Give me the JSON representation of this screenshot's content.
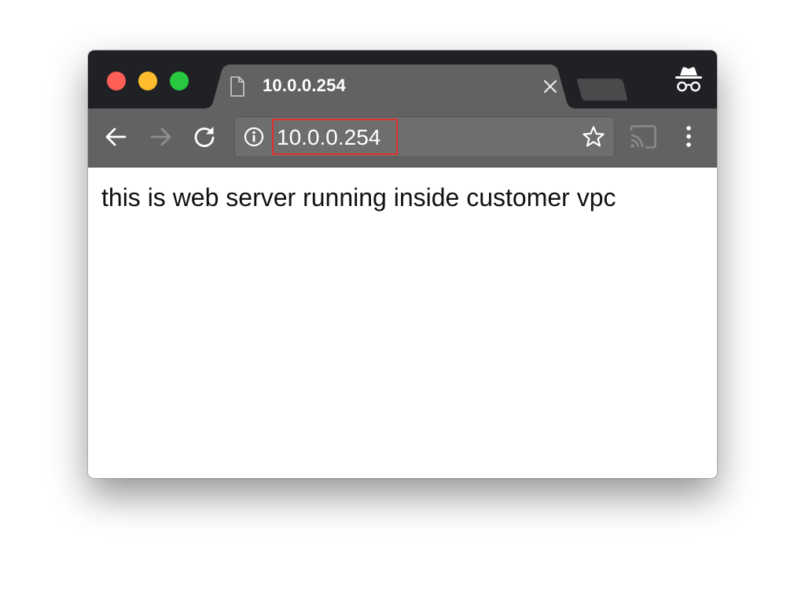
{
  "tab": {
    "title": "10.0.0.254",
    "icons": {
      "page": "document-icon",
      "close": "close-icon"
    }
  },
  "window_controls": {
    "close": "close-button",
    "minimize": "minimize-button",
    "maximize": "zoom-button"
  },
  "toolbar": {
    "back_icon": "arrow-left-icon",
    "forward_icon": "arrow-right-icon",
    "reload_icon": "reload-icon",
    "cast_icon": "cast-icon",
    "menu_icon": "three-dot-menu-icon"
  },
  "address_bar": {
    "url": "10.0.0.254",
    "site_info_icon": "info-icon",
    "bookmark_icon": "star-icon",
    "highlight_color": "#e0302a"
  },
  "profile": {
    "icon": "incognito-icon"
  },
  "page": {
    "body_text": "this is web server running inside customer vpc"
  },
  "colors": {
    "tabstrip": "#202124",
    "active_tab": "#626262",
    "toolbar": "#626262",
    "omnibox": "#6e6e6e",
    "traffic_close": "#fe5f57",
    "traffic_minimize": "#febc2e",
    "traffic_maximize": "#28c840"
  }
}
